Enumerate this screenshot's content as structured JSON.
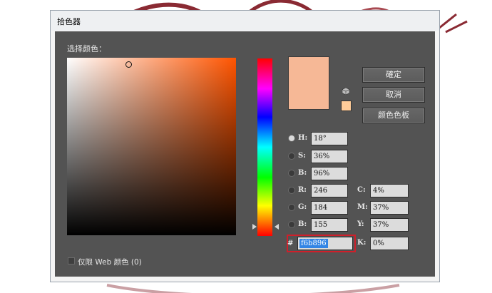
{
  "window": {
    "title": "拾色器"
  },
  "picker": {
    "section_label": "选择颜色："
  },
  "buttons": {
    "ok": "確定",
    "cancel": "取消",
    "swatches": "颜色色板"
  },
  "hsb": {
    "h": {
      "label": "H:",
      "value": "18°"
    },
    "s": {
      "label": "S:",
      "value": "36%"
    },
    "b": {
      "label": "B:",
      "value": "96%"
    }
  },
  "rgb": {
    "r": {
      "label": "R:",
      "value": "246"
    },
    "g": {
      "label": "G:",
      "value": "184"
    },
    "b": {
      "label": "B:",
      "value": "155"
    }
  },
  "cmyk": {
    "c": {
      "label": "C:",
      "value": "4%"
    },
    "m": {
      "label": "M:",
      "value": "37%"
    },
    "y": {
      "label": "Y:",
      "value": "37%"
    },
    "k": {
      "label": "K:",
      "value": "0%"
    }
  },
  "hex": {
    "label": "#",
    "value": "f6b896"
  },
  "web_only": {
    "label": "仅限 Web 颜色 (0)"
  },
  "colors": {
    "new_color": "#f6b896",
    "web_safe": "#ffcc99",
    "highlight": "#d01f2a",
    "selection": "#3385e5"
  },
  "icons": {
    "cube": "cube-icon"
  }
}
